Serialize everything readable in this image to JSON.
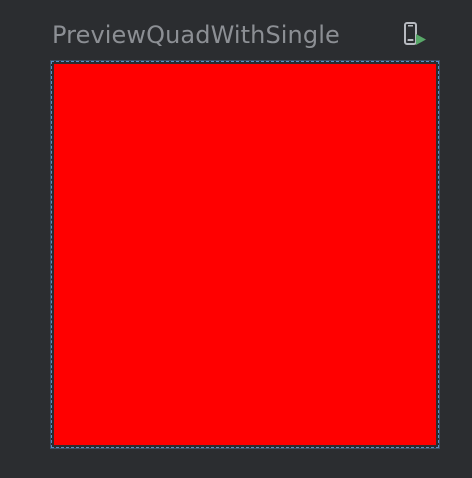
{
  "preview": {
    "title": "PreviewQuadWithSingle",
    "deploy_icon": "deploy-to-device-icon",
    "content_color": "#ff0000",
    "frame_border_color": "#5a8fc4",
    "background_color": "#2b2d30",
    "title_color": "#8c8f94",
    "icon_play_color": "#59a869"
  }
}
